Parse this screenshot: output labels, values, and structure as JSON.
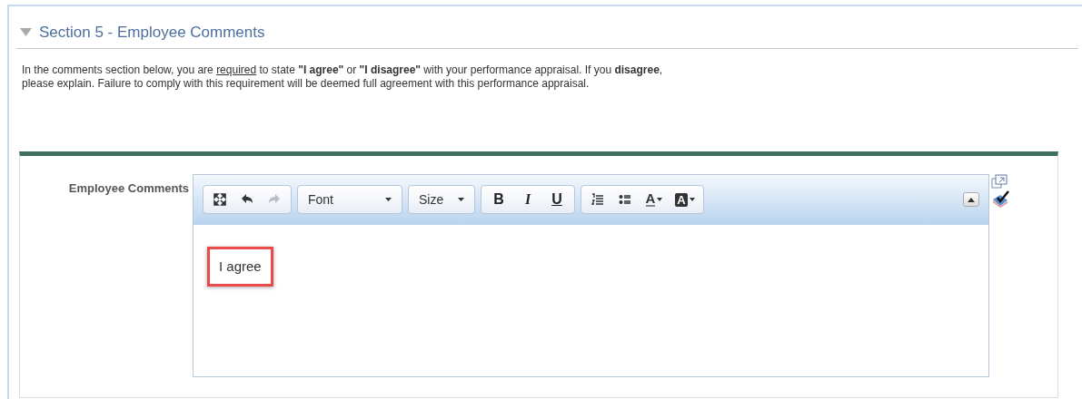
{
  "section": {
    "title": "Section 5 - Employee Comments",
    "expanded": true
  },
  "instructions": [
    {
      "text": "In the comments section below, you are ",
      "kind": "plain"
    },
    {
      "text": "required",
      "kind": "underline"
    },
    {
      "text": " to state ",
      "kind": "plain"
    },
    {
      "text": "\"I agree\"",
      "kind": "bold"
    },
    {
      "text": " or ",
      "kind": "plain"
    },
    {
      "text": "\"I disagree\"",
      "kind": "bold"
    },
    {
      "text": " with your performance appraisal. If you ",
      "kind": "plain"
    },
    {
      "text": "disagree",
      "kind": "bold"
    },
    {
      "text": ",",
      "kind": "plain"
    },
    {
      "text": "please explain. Failure to comply with this requirement will be deemed full agreement with this performance appraisal.",
      "kind": "newline"
    }
  ],
  "field_label": "Employee Comments",
  "toolbar": [
    [
      {
        "kind": "fullscreen"
      },
      {
        "kind": "undo"
      },
      {
        "kind": "redo",
        "disabled": true
      }
    ],
    [
      {
        "kind": "dropdown",
        "label": "Font"
      }
    ],
    [
      {
        "kind": "dropdown",
        "label": "Size"
      }
    ],
    [
      {
        "kind": "bold",
        "label": "B"
      },
      {
        "kind": "italic",
        "label": "I"
      },
      {
        "kind": "underline",
        "label": "U"
      }
    ],
    [
      {
        "kind": "ordered-list"
      },
      {
        "kind": "bullet-list"
      },
      {
        "kind": "text-color",
        "label": "A"
      },
      {
        "kind": "bg-color",
        "label": "A"
      }
    ]
  ],
  "editor_text": "I agree",
  "text_highlighted": true
}
